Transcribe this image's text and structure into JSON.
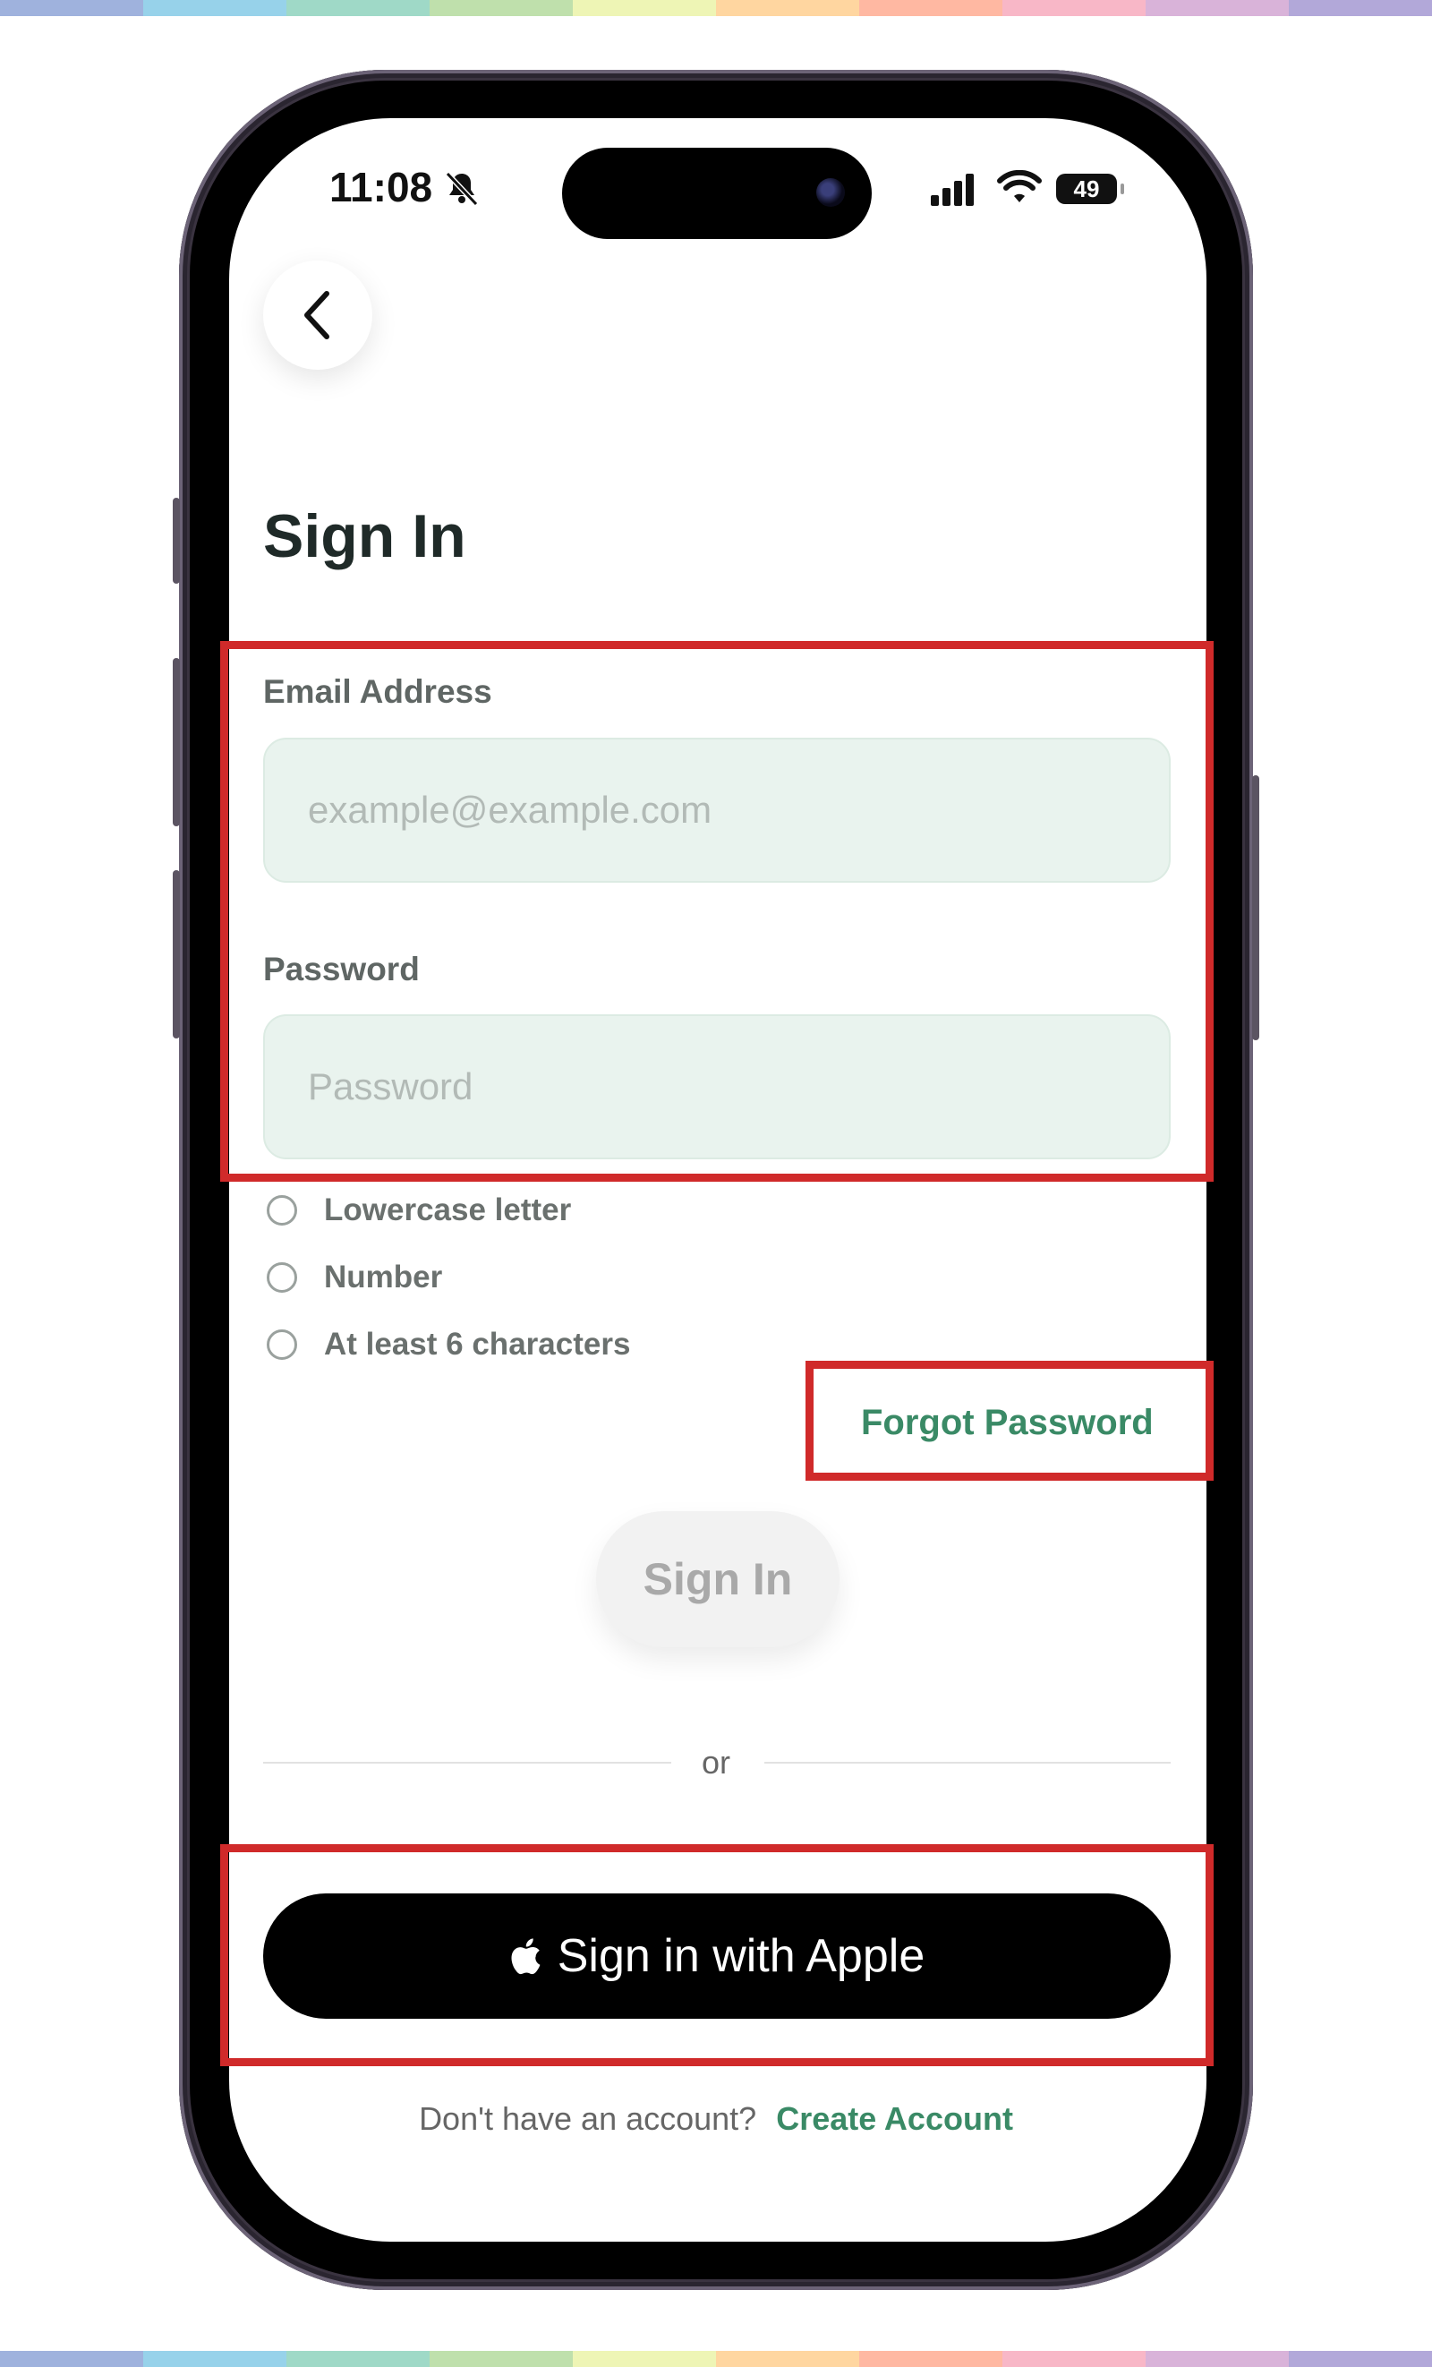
{
  "colors": {
    "rainbow": [
      "#9fb2dd",
      "#97d2ea",
      "#9fd9c7",
      "#bfe0ac",
      "#eef5b5",
      "#ffd6a0",
      "#ffb8a2",
      "#f8b7c7",
      "#d9b3d9",
      "#b2a8d9"
    ],
    "accent": "#3a8a66",
    "highlight": "#d02a2a"
  },
  "status_bar": {
    "time": "11:08",
    "battery": "49",
    "icons": [
      "bell-slash-icon",
      "signal-icon",
      "wifi-icon",
      "battery-icon"
    ]
  },
  "header": {
    "back_icon": "chevron-left-icon",
    "title": "Sign In"
  },
  "form": {
    "email": {
      "label": "Email Address",
      "placeholder": "example@example.com",
      "value": ""
    },
    "password": {
      "label": "Password",
      "placeholder": "Password",
      "value": ""
    },
    "requirements": [
      {
        "text": "Lowercase letter",
        "met": false
      },
      {
        "text": "Number",
        "met": false
      },
      {
        "text": "At least 6 characters",
        "met": false
      }
    ],
    "forgot_label": "Forgot Password",
    "submit_label": "Sign In"
  },
  "divider": {
    "label": "or"
  },
  "apple": {
    "label": "Sign in with Apple",
    "icon": "apple-logo-icon"
  },
  "footer": {
    "prompt": "Don't have an account?",
    "link": "Create Account"
  }
}
